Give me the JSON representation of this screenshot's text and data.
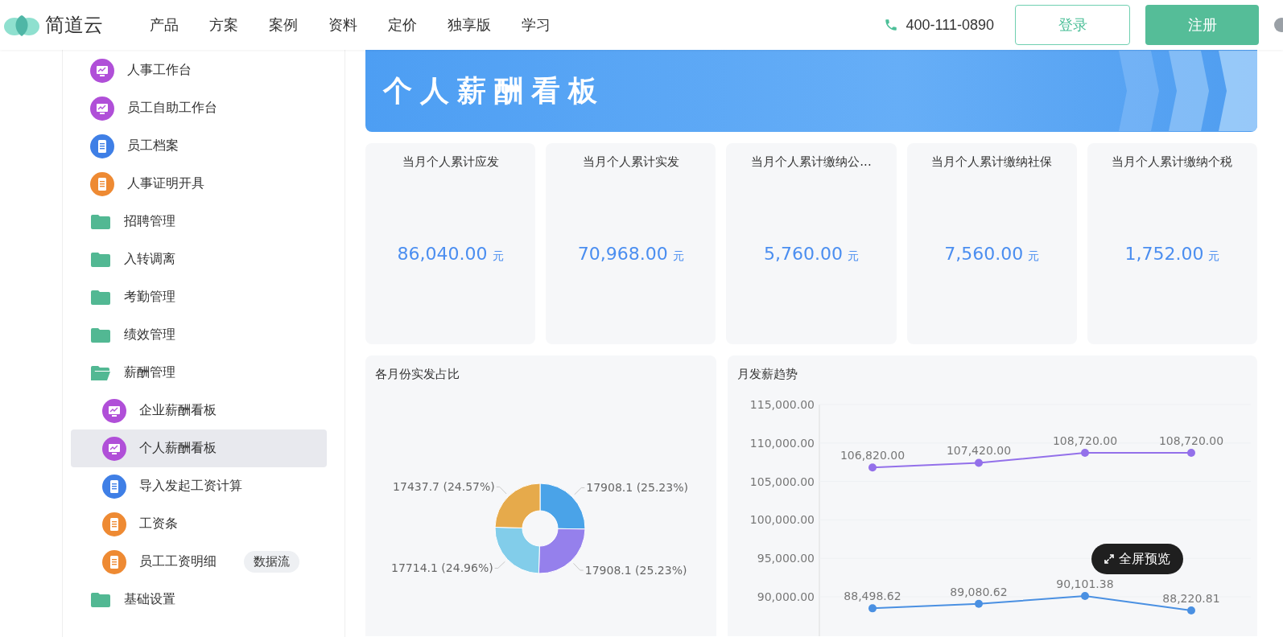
{
  "header": {
    "logo": "简道云",
    "nav": [
      "产品",
      "方案",
      "案例",
      "资料",
      "定价",
      "独享版",
      "学习"
    ],
    "phone": "400-111-0890",
    "login": "登录",
    "register": "注册"
  },
  "sidebar": {
    "items": [
      {
        "label": "人事工作台",
        "kind": "dashboard",
        "selected": false
      },
      {
        "label": "员工自助工作台",
        "kind": "dashboard",
        "selected": false
      },
      {
        "label": "员工档案",
        "kind": "form",
        "selected": false
      },
      {
        "label": "人事证明开具",
        "kind": "flow",
        "selected": false
      },
      {
        "label": "招聘管理",
        "kind": "folder",
        "expanded": false,
        "selected": false
      },
      {
        "label": "入转调离",
        "kind": "folder",
        "expanded": false,
        "selected": false
      },
      {
        "label": "考勤管理",
        "kind": "folder",
        "expanded": false,
        "selected": false
      },
      {
        "label": "绩效管理",
        "kind": "folder",
        "expanded": false,
        "selected": false
      },
      {
        "label": "薪酬管理",
        "kind": "folder",
        "expanded": true,
        "selected": false,
        "children": [
          {
            "label": "企业薪酬看板",
            "kind": "dashboard",
            "selected": false
          },
          {
            "label": "个人薪酬看板",
            "kind": "dashboard",
            "selected": true
          },
          {
            "label": "导入发起工资计算",
            "kind": "form",
            "selected": false
          },
          {
            "label": "工资条",
            "kind": "flow",
            "selected": false
          },
          {
            "label": "员工工资明细",
            "kind": "flow",
            "selected": false,
            "badge": "数据流"
          }
        ]
      },
      {
        "label": "基础设置",
        "kind": "folder",
        "expanded": false,
        "selected": false
      }
    ]
  },
  "banner": {
    "title": "个人薪酬看板"
  },
  "stats": [
    {
      "label": "当月个人累计应发",
      "value": "86,040.00",
      "unit": "元"
    },
    {
      "label": "当月个人累计实发",
      "value": "70,968.00",
      "unit": "元"
    },
    {
      "label": "当月个人累计缴纳公...",
      "value": "5,760.00",
      "unit": "元"
    },
    {
      "label": "当月个人累计缴纳社保",
      "value": "7,560.00",
      "unit": "元"
    },
    {
      "label": "当月个人累计缴纳个税",
      "value": "1,752.00",
      "unit": "元"
    }
  ],
  "donut_panel": {
    "title": "各月份实发占比",
    "chart_data": {
      "type": "donut",
      "values": [
        17908.1,
        17908.1,
        17714.1,
        17437.7
      ],
      "colors": [
        "#4aa3e8",
        "#9580ec",
        "#82cdea",
        "#e6aa4b"
      ],
      "value_labels": [
        "17908.1 (25.23%)",
        "17908.1 (25.23%)",
        "17714.1 (24.96%)",
        "17437.7 (24.57%)"
      ]
    }
  },
  "trend_panel": {
    "title": "月发薪趋势",
    "chart_data": {
      "type": "line",
      "data_labels": true,
      "grid": true,
      "ylim": [
        85000,
        115000
      ],
      "yticks": [
        {
          "value": 90000,
          "label": "90,000.00"
        },
        {
          "value": 95000,
          "label": "95,000.00"
        },
        {
          "value": 100000,
          "label": "100,000.00"
        },
        {
          "value": 105000,
          "label": "105,000.00"
        },
        {
          "value": 110000,
          "label": "110,000.00"
        },
        {
          "value": 115000,
          "label": "115,000.00"
        }
      ],
      "series": [
        {
          "color": "#9370ea",
          "marker": true,
          "values": [
            106820,
            107420,
            108720,
            108720
          ],
          "value_labels": [
            "106,820.00",
            "107,420.00",
            "108,720.00",
            "108,720.00"
          ]
        },
        {
          "color": "#4a90e2",
          "marker": true,
          "values": [
            88498.62,
            89080.62,
            90101.38,
            88220.81
          ],
          "value_labels": [
            "88,498.62",
            "89,080.62",
            "90,101.38",
            "88,220.81"
          ]
        }
      ]
    }
  },
  "fullscreen_button": "全屏预览"
}
